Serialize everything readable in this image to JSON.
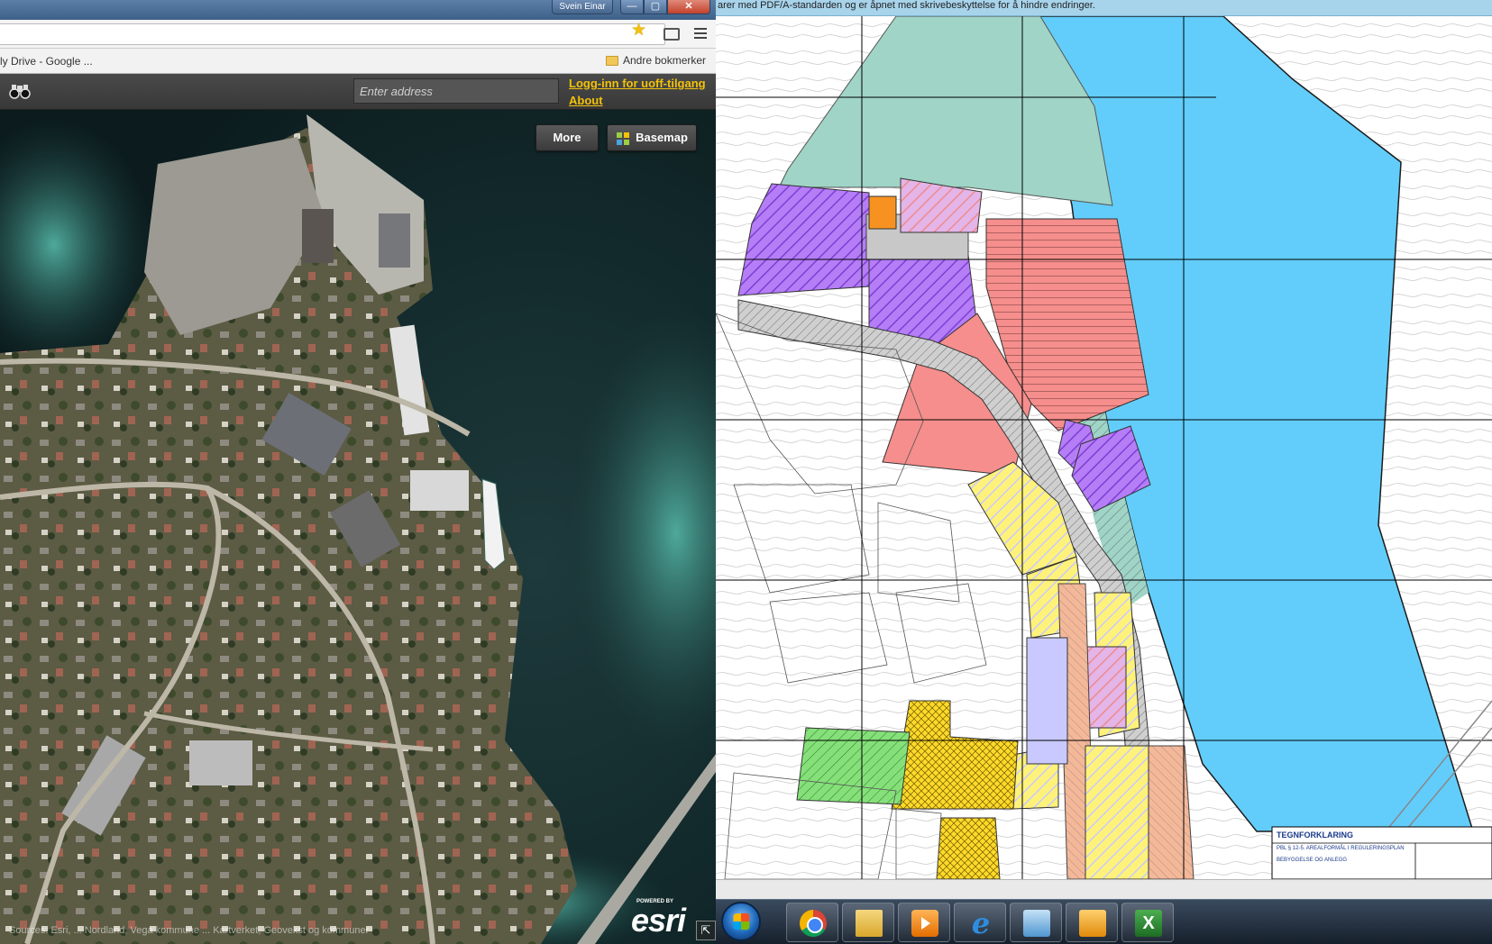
{
  "left_window": {
    "user_name": "Svein Einar",
    "window_controls": {
      "minimize": "—",
      "maximize": "▢",
      "close": "✕"
    },
    "bookmarks": {
      "first_item": "ly Drive - Google ...",
      "other": "Andre bokmerker"
    },
    "app": {
      "address_placeholder": "Enter address",
      "login_link": "Logg-inn for uoff-tilgang",
      "about_link": "About"
    },
    "map": {
      "more_button": "More",
      "basemap_button": "Basemap",
      "esri_powered": "POWERED BY",
      "esri_logo": "esri",
      "attribution": "Sources: Esri, ... Nordland, Vega kommune ... Kartverket, Geovekst og kommuner"
    }
  },
  "right_window": {
    "info_bar": "arer med PDF/A-standarden og er åpnet med skrivebeskyttelse for å hindre endringer.",
    "plan_labels": {
      "legend_title": "TEGNFORKLARING",
      "legend_line": "PBL § 12-5. AREALFORMÅL I REGULERINGSPLAN",
      "legend_sub": "BEBYGGELSE OG ANLEGG"
    }
  },
  "colors": {
    "water_blue": "#62cdfb",
    "residential_purple": "#b57ef7",
    "commercial_red": "#f58e8c",
    "mixed_yellow": "#ffee55",
    "green_area": "#85e07a",
    "teal_area": "#9fd4c6",
    "road_salmon": "#f4b899",
    "link_yellow": "#f2c20a"
  }
}
